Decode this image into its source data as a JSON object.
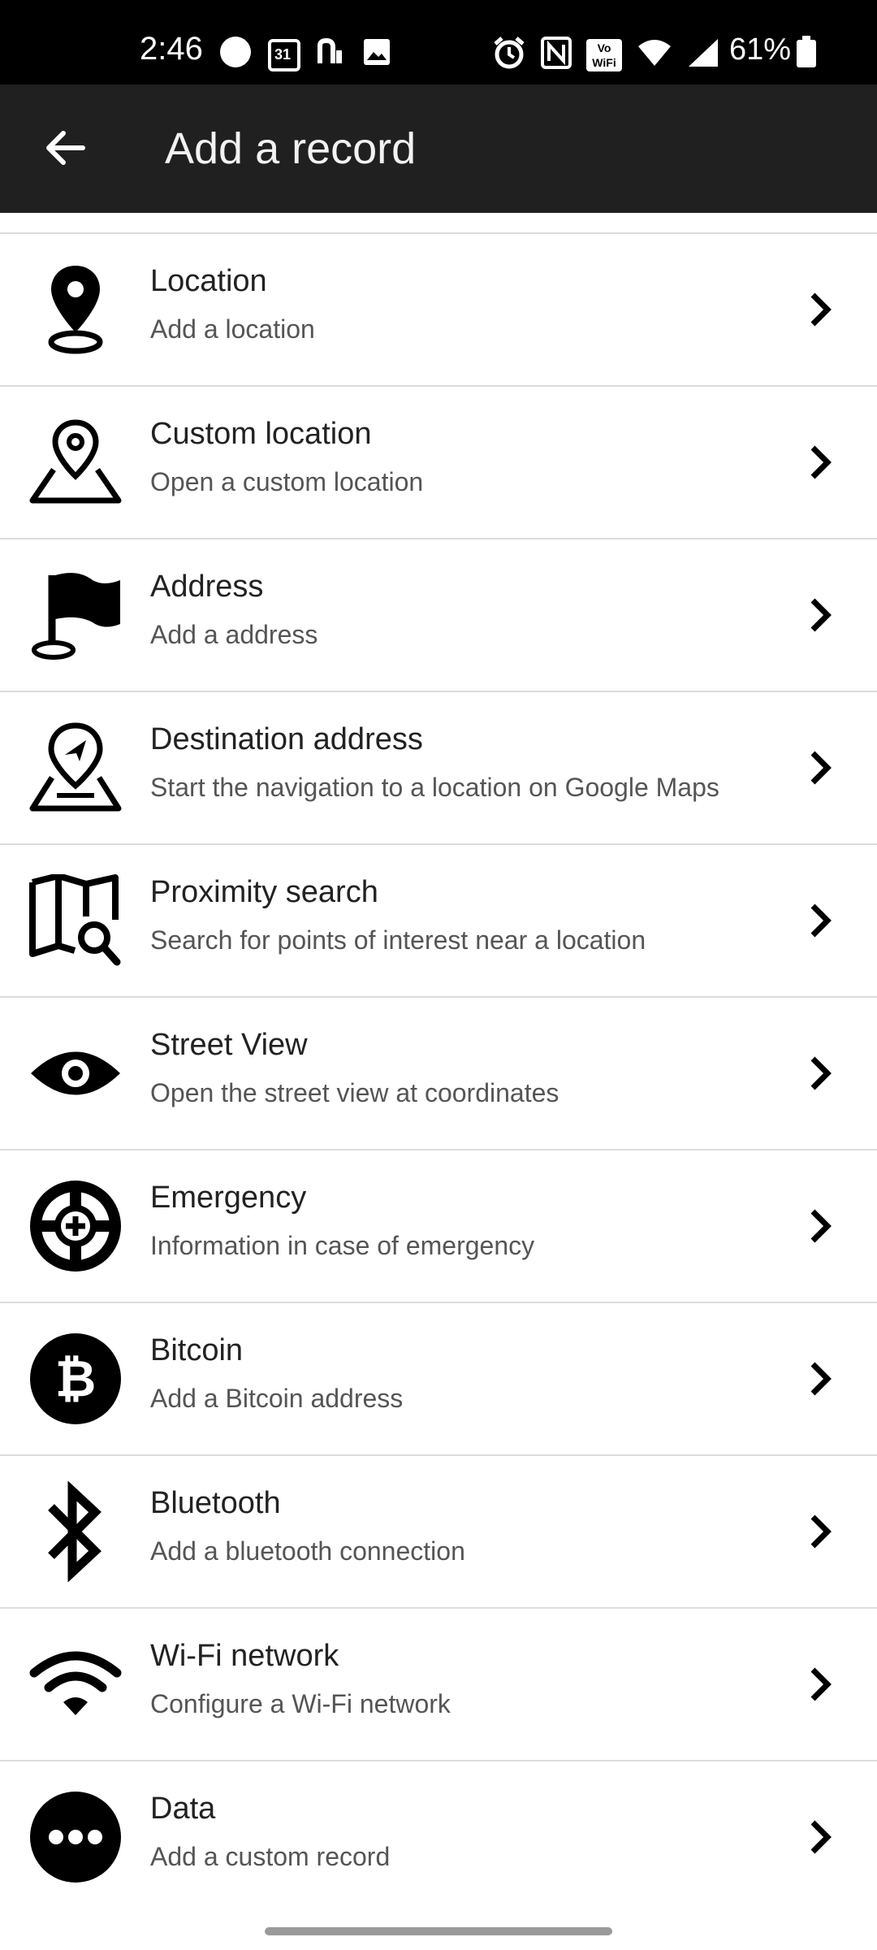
{
  "status_bar": {
    "time": "2:46",
    "battery_text": "61%",
    "icons_left": [
      "circle-icon",
      "calendar-icon",
      "n-app-icon",
      "image-icon"
    ],
    "calendar_text": "31",
    "icons_right": [
      "alarm-icon",
      "nfc-icon",
      "vowifi-icon",
      "wifi-icon",
      "signal-icon",
      "battery-icon"
    ],
    "vowifi_text": "Vo WiFi"
  },
  "app_bar": {
    "title": "Add a record",
    "back_icon": "arrow-left-icon",
    "background": "#202020"
  },
  "items": [
    {
      "title": "Location",
      "subtitle": "Add a location",
      "icon": "map-pin-icon"
    },
    {
      "title": "Custom location",
      "subtitle": "Open a custom location",
      "icon": "map-pin-area-icon"
    },
    {
      "title": "Address",
      "subtitle": "Add a address",
      "icon": "flag-icon"
    },
    {
      "title": "Destination address",
      "subtitle": "Start the navigation to a location on Google Maps",
      "icon": "navigation-pin-icon"
    },
    {
      "title": "Proximity search",
      "subtitle": "Search for points of interest near a location",
      "icon": "map-search-icon"
    },
    {
      "title": "Street View",
      "subtitle": "Open the street view at coordinates",
      "icon": "eye-icon"
    },
    {
      "title": "Emergency",
      "subtitle": "Information in case of emergency",
      "icon": "emergency-lifebuoy-icon"
    },
    {
      "title": "Bitcoin",
      "subtitle": "Add a Bitcoin address",
      "icon": "bitcoin-icon"
    },
    {
      "title": "Bluetooth",
      "subtitle": "Add a bluetooth connection",
      "icon": "bluetooth-icon"
    },
    {
      "title": "Wi-Fi network",
      "subtitle": "Configure a Wi-Fi network",
      "icon": "wifi-icon"
    },
    {
      "title": "Data",
      "subtitle": "Add a custom record",
      "icon": "more-dots-icon"
    }
  ]
}
